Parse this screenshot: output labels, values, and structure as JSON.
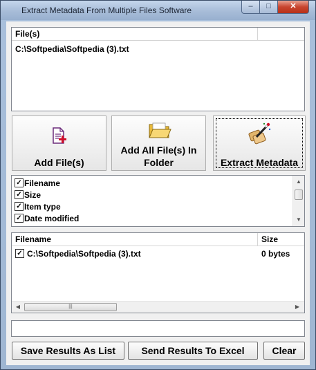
{
  "window": {
    "title": "Extract Metadata From Multiple Files Software",
    "minimize_glyph": "–",
    "maximize_glyph": "□",
    "close_glyph": "✕"
  },
  "files_list": {
    "column_header": "File(s)",
    "items": [
      "C:\\Softpedia\\Softpedia (3).txt"
    ]
  },
  "actions": {
    "add_files_label": "Add File(s)",
    "add_folder_label_line1": "Add All File(s) In",
    "add_folder_label_line2": "Folder",
    "extract_label": "Extract Metadata",
    "add_files_icon": "document-add-icon",
    "add_folder_icon": "folder-open-icon",
    "extract_icon": "extract-wand-icon"
  },
  "properties": [
    {
      "label": "Filename",
      "checked": true
    },
    {
      "label": "Size",
      "checked": true
    },
    {
      "label": "Item type",
      "checked": true
    },
    {
      "label": "Date modified",
      "checked": true
    }
  ],
  "results": {
    "headers": [
      "Filename",
      "Size"
    ],
    "rows": [
      {
        "filename": "C:\\Softpedia\\Softpedia (3).txt",
        "size": "0 bytes",
        "checked": true
      }
    ]
  },
  "status_text": "",
  "footer": {
    "save_label": "Save Results As List",
    "excel_label": "Send Results To Excel",
    "clear_label": "Clear"
  },
  "colors": {
    "title_bar": "#a7bcd8",
    "close_button": "#c8452f",
    "client_bg": "#f0f0f0"
  }
}
